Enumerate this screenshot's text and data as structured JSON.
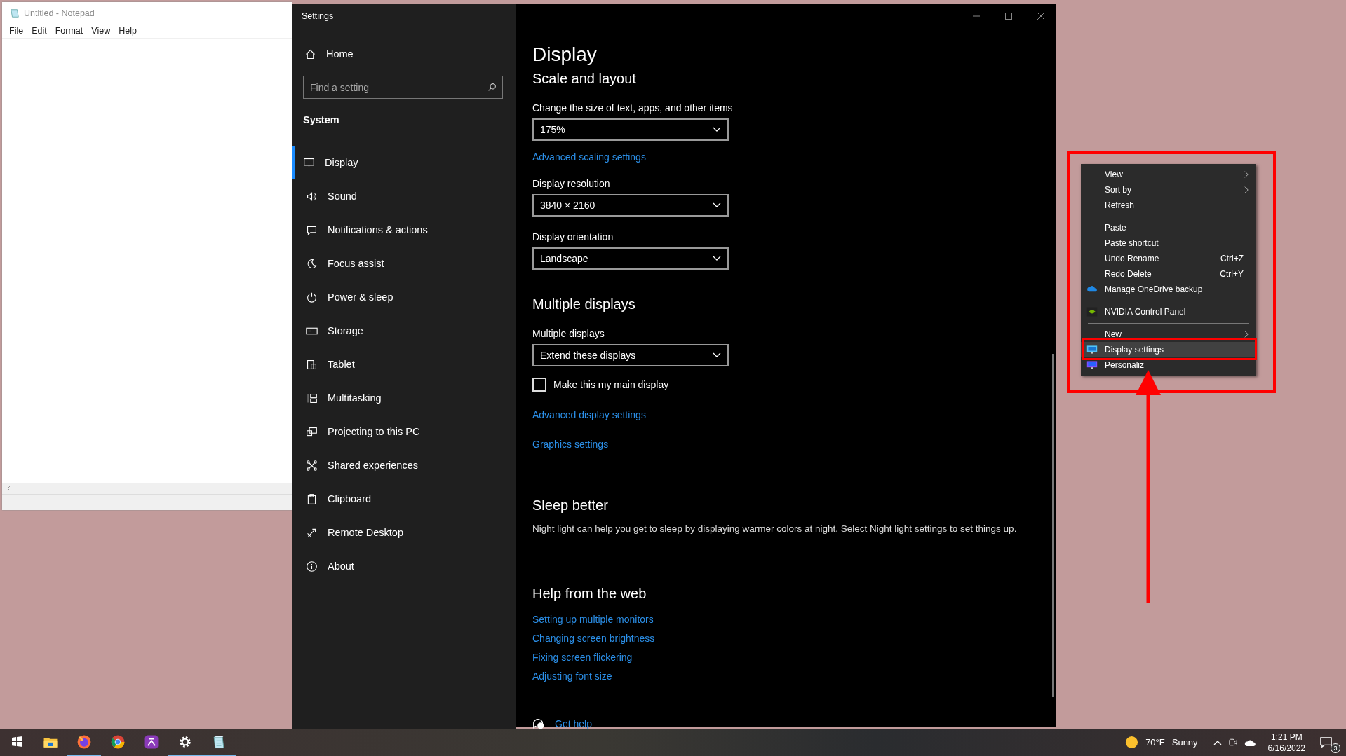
{
  "notepad": {
    "title": "Untitled - Notepad",
    "menu": [
      "File",
      "Edit",
      "Format",
      "View",
      "Help"
    ]
  },
  "settings": {
    "title": "Settings",
    "sidebar": {
      "home": "Home",
      "search": {
        "placeholder": "Find a setting"
      },
      "section": "System",
      "items": [
        {
          "label": "Display",
          "selected": true
        },
        {
          "label": "Sound",
          "selected": false
        },
        {
          "label": "Notifications & actions",
          "selected": false
        },
        {
          "label": "Focus assist",
          "selected": false
        },
        {
          "label": "Power & sleep",
          "selected": false
        },
        {
          "label": "Storage",
          "selected": false
        },
        {
          "label": "Tablet",
          "selected": false
        },
        {
          "label": "Multitasking",
          "selected": false
        },
        {
          "label": "Projecting to this PC",
          "selected": false
        },
        {
          "label": "Shared experiences",
          "selected": false
        },
        {
          "label": "Clipboard",
          "selected": false
        },
        {
          "label": "Remote Desktop",
          "selected": false
        },
        {
          "label": "About",
          "selected": false
        }
      ]
    },
    "page": {
      "title": "Display",
      "sections": [
        {
          "heading": "Scale and layout",
          "blocks": [
            {
              "kind": "dropdown",
              "label": "Change the size of text, apps, and other items",
              "value": "175%"
            },
            {
              "kind": "link",
              "text": "Advanced scaling settings"
            },
            {
              "kind": "dropdown",
              "label": "Display resolution",
              "value": "3840 × 2160"
            },
            {
              "kind": "dropdown",
              "label": "Display orientation",
              "value": "Landscape"
            }
          ]
        },
        {
          "heading": "Multiple displays",
          "blocks": [
            {
              "kind": "dropdown",
              "label": "Multiple displays",
              "value": "Extend these displays"
            },
            {
              "kind": "checkbox",
              "label": "Make this my main display",
              "checked": false
            },
            {
              "kind": "link",
              "text": "Advanced display settings"
            },
            {
              "kind": "link",
              "text": "Graphics settings"
            }
          ]
        },
        {
          "heading": "Sleep better",
          "blocks": [
            {
              "kind": "text",
              "text": "Night light can help you get to sleep by displaying warmer colors at night. Select Night light settings to set things up."
            }
          ]
        },
        {
          "heading": "Help from the web",
          "blocks": [
            {
              "kind": "link",
              "text": "Setting up multiple monitors"
            },
            {
              "kind": "link",
              "text": "Changing screen brightness"
            },
            {
              "kind": "link",
              "text": "Fixing screen flickering"
            },
            {
              "kind": "link",
              "text": "Adjusting font size"
            }
          ]
        }
      ],
      "get_help": "Get help"
    }
  },
  "context_menu": {
    "groups": [
      [
        {
          "label": "View",
          "kind": "text",
          "submenu": true,
          "selected": false
        },
        {
          "label": "Sort by",
          "kind": "text",
          "submenu": true,
          "selected": false
        },
        {
          "label": "Refresh",
          "kind": "text",
          "submenu": false,
          "selected": false
        }
      ],
      [
        {
          "label": "Paste",
          "kind": "text",
          "submenu": false,
          "selected": false
        },
        {
          "label": "Paste shortcut",
          "kind": "text",
          "submenu": false,
          "selected": false
        },
        {
          "label": "Undo Rename",
          "shortcut": "Ctrl+Z",
          "kind": "text",
          "submenu": false,
          "selected": false
        },
        {
          "label": "Redo Delete",
          "shortcut": "Ctrl+Y",
          "kind": "text",
          "submenu": false,
          "selected": false
        },
        {
          "label": "Manage OneDrive backup",
          "kind": "app",
          "submenu": false,
          "selected": false
        }
      ],
      [
        {
          "label": "NVIDIA Control Panel",
          "kind": "app",
          "submenu": false,
          "selected": false
        }
      ],
      [
        {
          "label": "New",
          "kind": "text",
          "submenu": true,
          "selected": false
        },
        {
          "label": "Display settings",
          "kind": "app",
          "submenu": false,
          "selected": true
        },
        {
          "label": "Personaliz",
          "kind": "app",
          "submenu": false,
          "selected": false
        }
      ]
    ]
  },
  "taskbar": {
    "apps": [
      {
        "running": false
      },
      {
        "running": true
      },
      {
        "running": false
      },
      {
        "running": false
      },
      {
        "running": true
      },
      {
        "running": true
      }
    ],
    "weather": {
      "temperature": "70°F",
      "condition": "Sunny"
    },
    "time": "1:21 PM",
    "date": "6/16/2022",
    "notifications": "3"
  }
}
